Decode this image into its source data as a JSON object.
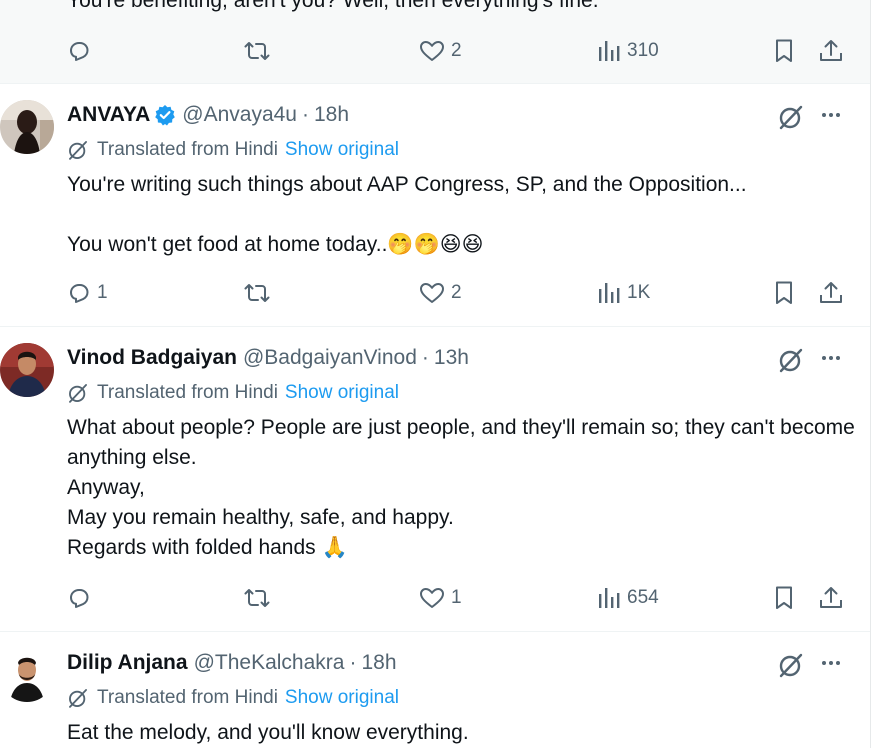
{
  "colors": {
    "text": "#0f1419",
    "muted": "#536471",
    "link": "#1d9bf0",
    "verified": "#1d9bf0",
    "divider": "#eff3f4"
  },
  "top_post": {
    "partial_text": "You're benefiting, aren't you? Well, then everything's fine.",
    "actions": {
      "replies": "",
      "retweets": "",
      "likes": "2",
      "views": "310"
    }
  },
  "posts": [
    {
      "name": "ANVAYA",
      "verified": true,
      "handle": "@Anvaya4u",
      "dot": "·",
      "time": "18h",
      "translated_label": "Translated from Hindi",
      "show_original": "Show original",
      "text": "You're writing such things about AAP Congress, SP, and the Opposition...\n\nYou won't get food at home today..🤭🤭😆😆",
      "actions": {
        "replies": "1",
        "retweets": "",
        "likes": "2",
        "views": "1K"
      }
    },
    {
      "name": "Vinod Badgaiyan",
      "verified": false,
      "handle": "@BadgaiyanVinod",
      "dot": "·",
      "time": "13h",
      "translated_label": "Translated from Hindi",
      "show_original": "Show original",
      "text": "What about people? People are just people, and they'll remain so; they can't become anything else.\nAnyway,\nMay you remain healthy, safe, and happy.\nRegards with folded hands 🙏",
      "actions": {
        "replies": "",
        "retweets": "",
        "likes": "1",
        "views": "654"
      }
    },
    {
      "name": "Dilip Anjana",
      "verified": false,
      "handle": "@TheKalchakra",
      "dot": "·",
      "time": "18h",
      "translated_label": "Translated from Hindi",
      "show_original": "Show original",
      "text": "Eat the melody, and you'll know everything."
    }
  ]
}
